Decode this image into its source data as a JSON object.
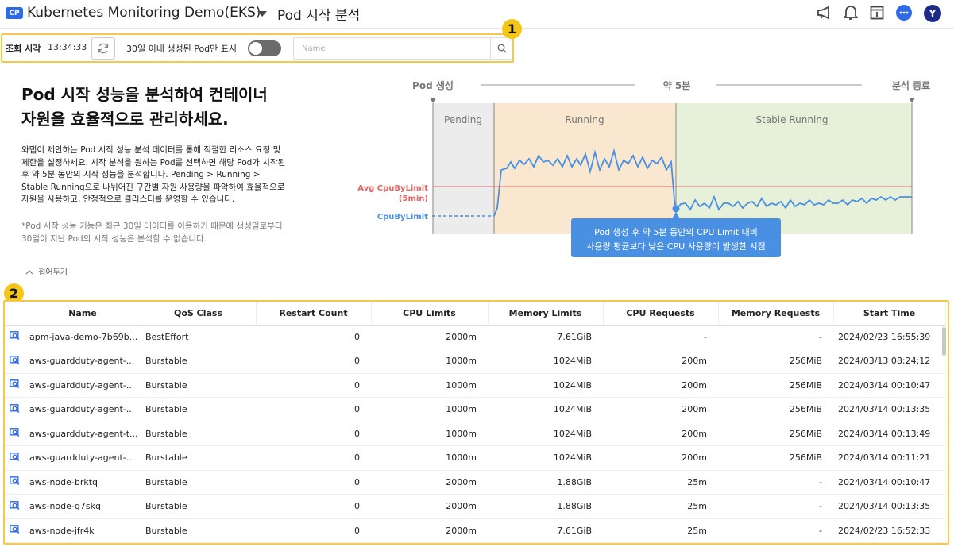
{
  "header": {
    "badge": "CP",
    "project": "Kubernetes Monitoring Demo(EKS)",
    "page_title": "Pod 시작 분석",
    "avatar_initial": "Y",
    "icons": [
      "megaphone-icon",
      "bell-icon",
      "panel-icon",
      "chat-icon"
    ],
    "accent_color": "#2f6be6"
  },
  "toolbar": {
    "query_time_label": "조회 시각",
    "query_time": "13:34:33",
    "filter_label": "30일 이내 생성된 Pod만 표시",
    "toggle_on": false,
    "search_placeholder": "Name",
    "search_value": ""
  },
  "markers": {
    "one": "1",
    "two": "2"
  },
  "intro": {
    "title_lines": [
      "Pod 시작 성능을 분석하여 컨테이너",
      "자원을 효율적으로 관리하세요."
    ],
    "body_lines": [
      "와탭이 제안하는 Pod 시작 성능 분석 데이터를 통해 적절한 리소스 요청 및",
      "제한을 설정하세요. 시작 분석을 원하는 Pod를 선택하면 해당 Pod가 시작된",
      "후 약 5분 동안의 시작 성능을 분석합니다. Pending > Running >",
      "Stable Running으로 나뉘어진 구간별 자원 사용량을 파악하여 효율적으로",
      "자원을 사용하고, 안정적으로 클러스터를 운영할 수 있습니다."
    ],
    "note_lines": [
      "*Pod 시작 성능 기능은 최근 30일 데이터를 이용하기 때문에 생성일로부터",
      "30일이 지난 Pod의 시작 성능은 분석할 수 없습니다."
    ],
    "collapse_label": "접어두기"
  },
  "diagram": {
    "start_label": "Pod 생성",
    "mid_label": "약 5분",
    "end_label": "분석 종료",
    "phases": [
      "Pending",
      "Running",
      "Stable Running"
    ],
    "phase_colors": [
      "#ececec",
      "#f9e8cf",
      "#e7f1d9"
    ],
    "avg_label_1": "Avg CpuByLimit",
    "avg_label_2": "(5min)",
    "cpu_label": "CpuByLimit",
    "tooltip_1": "Pod 생성 후 약 5분 동안의 CPU Limit 대비",
    "tooltip_2": "사용량 평균보다 낮은 CPU 사용량이 발생한 시점",
    "avg_color": "#e06666",
    "line_color": "#4a90e2"
  },
  "table": {
    "columns": [
      "Name",
      "QoS Class",
      "Restart Count",
      "CPU Limits",
      "Memory Limits",
      "CPU Requests",
      "Memory Requests",
      "Start Time"
    ],
    "rows": [
      [
        "apm-java-demo-7b69b...",
        "BestEffort",
        "0",
        "2000m",
        "7.61GiB",
        "-",
        "-",
        "2024/02/23 16:55:39"
      ],
      [
        "aws-guardduty-agent-...",
        "Burstable",
        "0",
        "1000m",
        "1024MiB",
        "200m",
        "256MiB",
        "2024/03/13 08:24:12"
      ],
      [
        "aws-guardduty-agent-...",
        "Burstable",
        "0",
        "1000m",
        "1024MiB",
        "200m",
        "256MiB",
        "2024/03/14 00:10:47"
      ],
      [
        "aws-guardduty-agent-...",
        "Burstable",
        "0",
        "1000m",
        "1024MiB",
        "200m",
        "256MiB",
        "2024/03/14 00:13:35"
      ],
      [
        "aws-guardduty-agent-t...",
        "Burstable",
        "0",
        "1000m",
        "1024MiB",
        "200m",
        "256MiB",
        "2024/03/14 00:13:49"
      ],
      [
        "aws-guardduty-agent-...",
        "Burstable",
        "0",
        "1000m",
        "1024MiB",
        "200m",
        "256MiB",
        "2024/03/14 00:11:21"
      ],
      [
        "aws-node-brktq",
        "Burstable",
        "0",
        "2000m",
        "1.88GiB",
        "25m",
        "-",
        "2024/03/14 00:10:47"
      ],
      [
        "aws-node-g7skq",
        "Burstable",
        "0",
        "2000m",
        "1.88GiB",
        "25m",
        "-",
        "2024/03/14 00:13:35"
      ],
      [
        "aws-node-jfr4k",
        "Burstable",
        "0",
        "2000m",
        "7.61GiB",
        "25m",
        "-",
        "2024/02/23 16:52:33"
      ]
    ]
  }
}
